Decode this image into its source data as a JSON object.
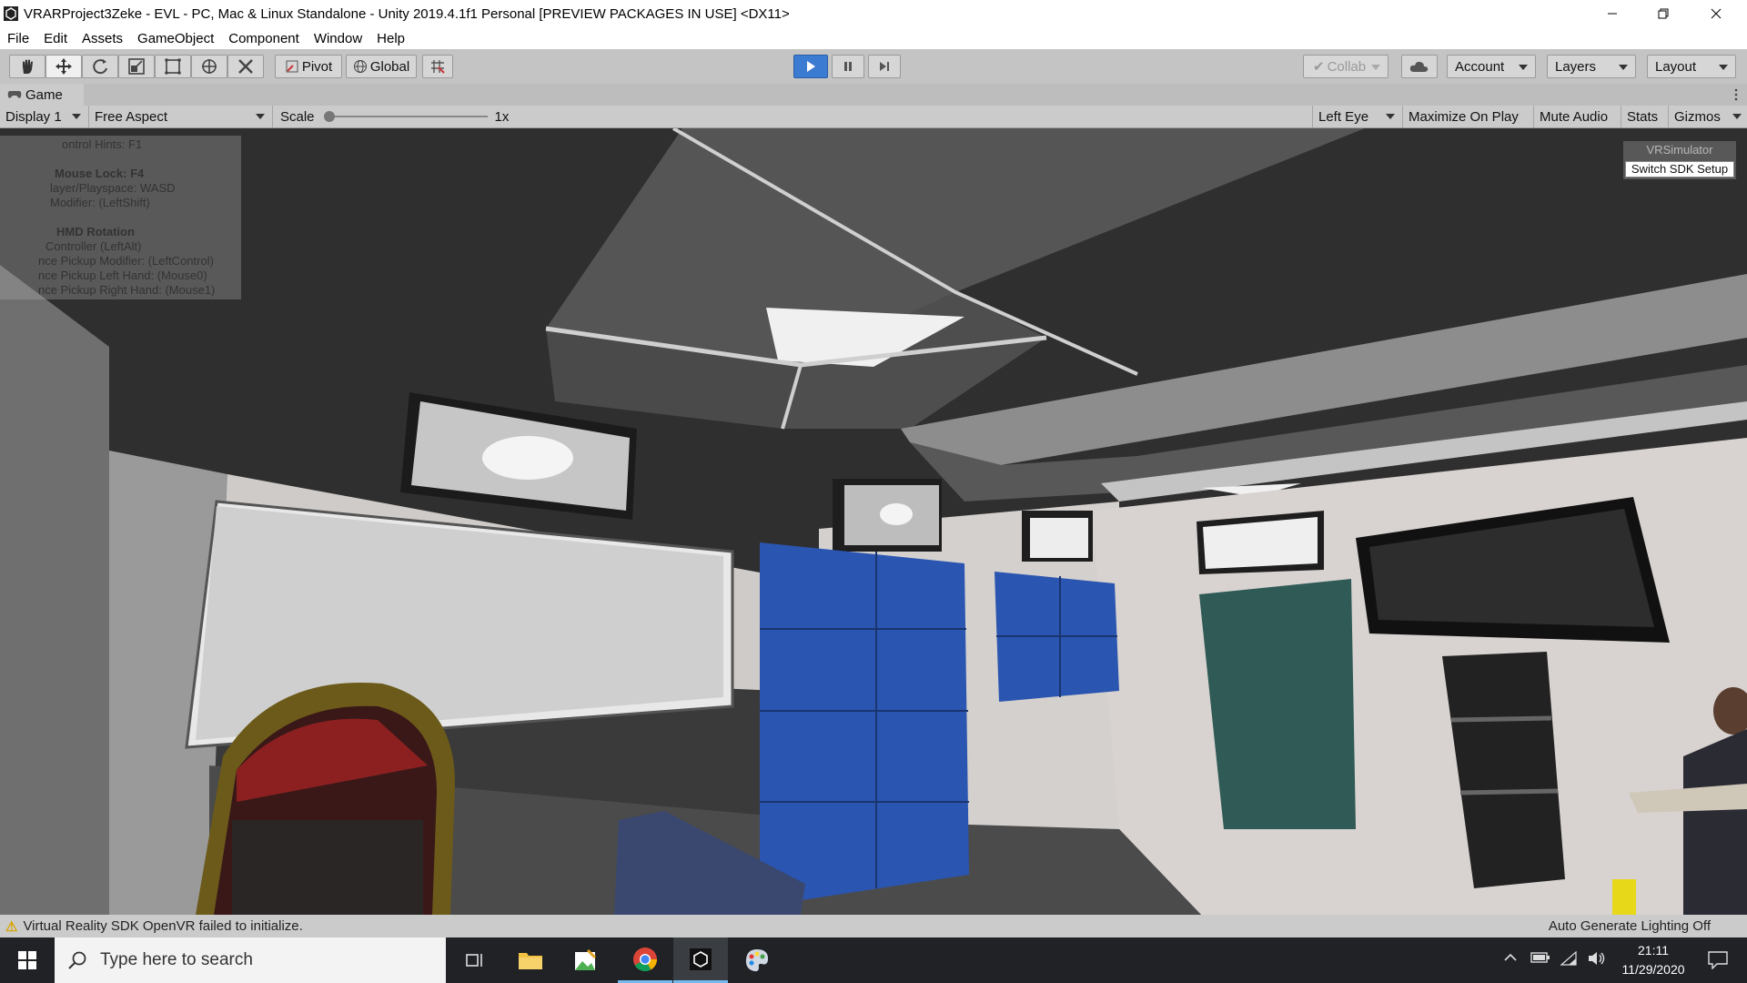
{
  "window": {
    "title": "VRARProject3Zeke - EVL - PC, Mac & Linux Standalone - Unity 2019.4.1f1 Personal [PREVIEW PACKAGES IN USE] <DX11>"
  },
  "menu": [
    "File",
    "Edit",
    "Assets",
    "GameObject",
    "Component",
    "Window",
    "Help"
  ],
  "toolbar": {
    "pivot_label": "Pivot",
    "global_label": "Global",
    "collab_label": "Collab",
    "account_label": "Account",
    "layers_label": "Layers",
    "layout_label": "Layout"
  },
  "game_tab": {
    "label": "Game"
  },
  "game_bar": {
    "display": "Display 1",
    "aspect": "Free Aspect",
    "scale_label": "Scale",
    "scale_value": "1x",
    "scale_fraction": 0.0,
    "eye": "Left Eye",
    "maximize": "Maximize On Play",
    "mute": "Mute Audio",
    "stats": "Stats",
    "gizmos": "Gizmos"
  },
  "overlay": {
    "hints": [
      "ontrol Hints: F1",
      "",
      "Mouse Lock: F4",
      "layer/Playspace: WASD",
      "Modifier: (LeftShift)",
      "",
      "HMD Rotation",
      "Controller (LeftAlt)",
      "nce Pickup Modifier: (LeftControl)",
      "nce Pickup Left Hand: (Mouse0)",
      "nce Pickup Right Hand: (Mouse1)"
    ],
    "sdk_faded": "VRSimulator",
    "sdk_button": "Switch SDK Setup"
  },
  "status": {
    "warning": "Virtual Reality SDK OpenVR failed to initialize.",
    "lighting": "Auto Generate Lighting Off"
  },
  "taskbar": {
    "search_placeholder": "Type here to search",
    "time": "21:11",
    "date": "11/29/2020"
  },
  "colors": {
    "play_active": "#3b7bd1",
    "blue_panels": "#2a55b0",
    "door": "#2f5a55"
  }
}
